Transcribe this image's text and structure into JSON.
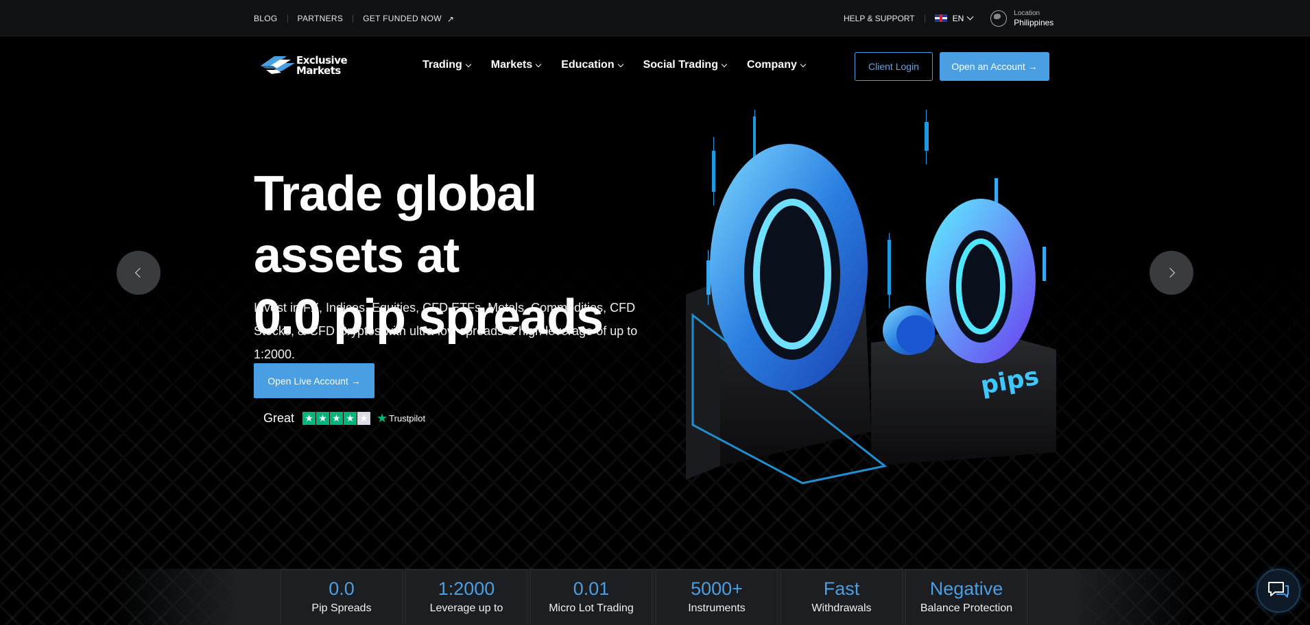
{
  "topbar": {
    "links": [
      "BLOG",
      "PARTNERS",
      "GET FUNDED NOW"
    ],
    "help": "HELP & SUPPORT",
    "language": "EN",
    "location_label": "Location",
    "location_value": "Philippines"
  },
  "brand": {
    "line1": "Exclusive",
    "line2": "Markets"
  },
  "nav": {
    "items": [
      "Trading",
      "Markets",
      "Education",
      "Social Trading",
      "Company"
    ],
    "client_login": "Client Login",
    "open_account": "Open an Account →"
  },
  "hero": {
    "title_line1": "Trade global assets at",
    "title_line2": "0.0 pip spreads",
    "subtitle": "Invest in FX, Indices, Equities, CFD ETFs, Metals, Commodities, CFD Stocks, & CFD Cryptos with ultra-low spreads & high leverage of up to 1:2000.",
    "cta": "Open Live Account →",
    "rating_label": "Great",
    "rating_stars": 4.5,
    "rating_source": "Trustpilot",
    "illustration_text": "pips"
  },
  "stats": [
    {
      "value": "0.0",
      "label": "Pip Spreads"
    },
    {
      "value": "1:2000",
      "label": "Leverage up to"
    },
    {
      "value": "0.01",
      "label": "Micro Lot Trading"
    },
    {
      "value": "5000+",
      "label": "Instruments"
    },
    {
      "value": "Fast",
      "label": "Withdrawals"
    },
    {
      "value": "Negative",
      "label": "Balance Protection"
    }
  ],
  "colors": {
    "accent": "#4a9fe3",
    "background": "#000000",
    "trustpilot": "#00b67a"
  }
}
